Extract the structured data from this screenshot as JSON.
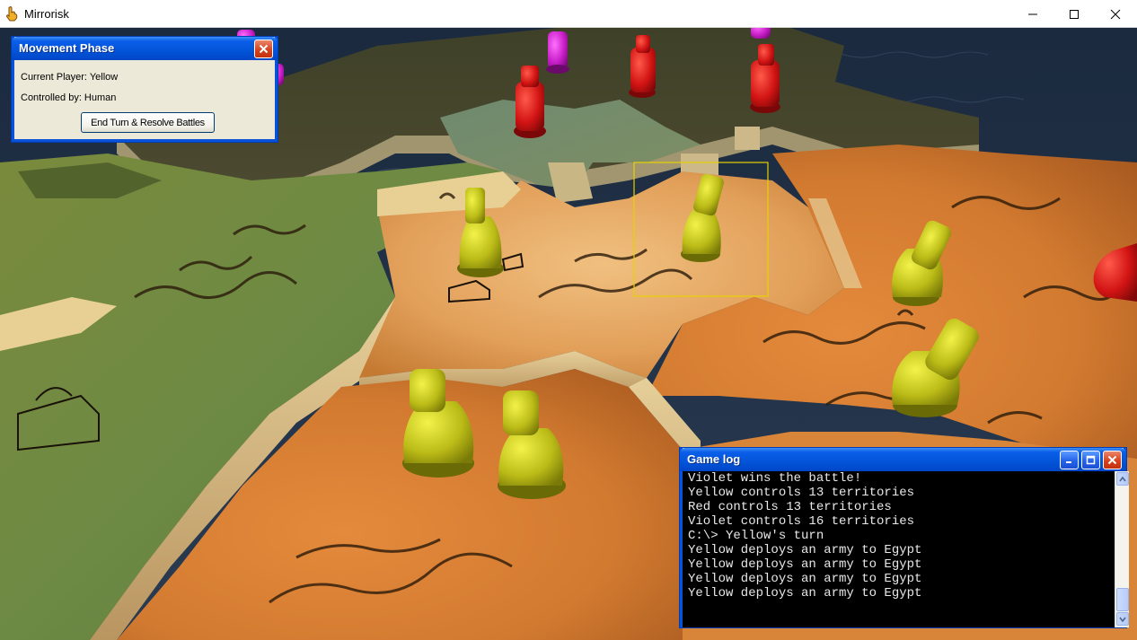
{
  "window": {
    "title": "Mirrorisk",
    "app_icon": "hand-pointer-icon",
    "controls": [
      "minimize-icon",
      "maximize-icon",
      "close-icon"
    ]
  },
  "movement_panel": {
    "title": "Movement Phase",
    "current_player": "Current Player: Yellow",
    "controlled_by": "Controlled by: Human",
    "end_turn_button": "End Turn & Resolve Battles"
  },
  "game_log": {
    "title": "Game log",
    "lines": [
      "Violet wins the battle!",
      "Yellow controls 13 territories",
      "Red controls 13 territories",
      "Violet controls 16 territories",
      "C:\\> Yellow's turn",
      "Yellow deploys an army to Egypt",
      "Yellow deploys an army to Egypt",
      "Yellow deploys an army to Egypt",
      "Yellow deploys an army to Egypt"
    ]
  },
  "colors": {
    "yellow_army": "#c8c81e",
    "red_army": "#d21414",
    "violet_army": "#c81ec8",
    "xp_blue": "#0a52d8",
    "selection_box": "#e6d200"
  }
}
